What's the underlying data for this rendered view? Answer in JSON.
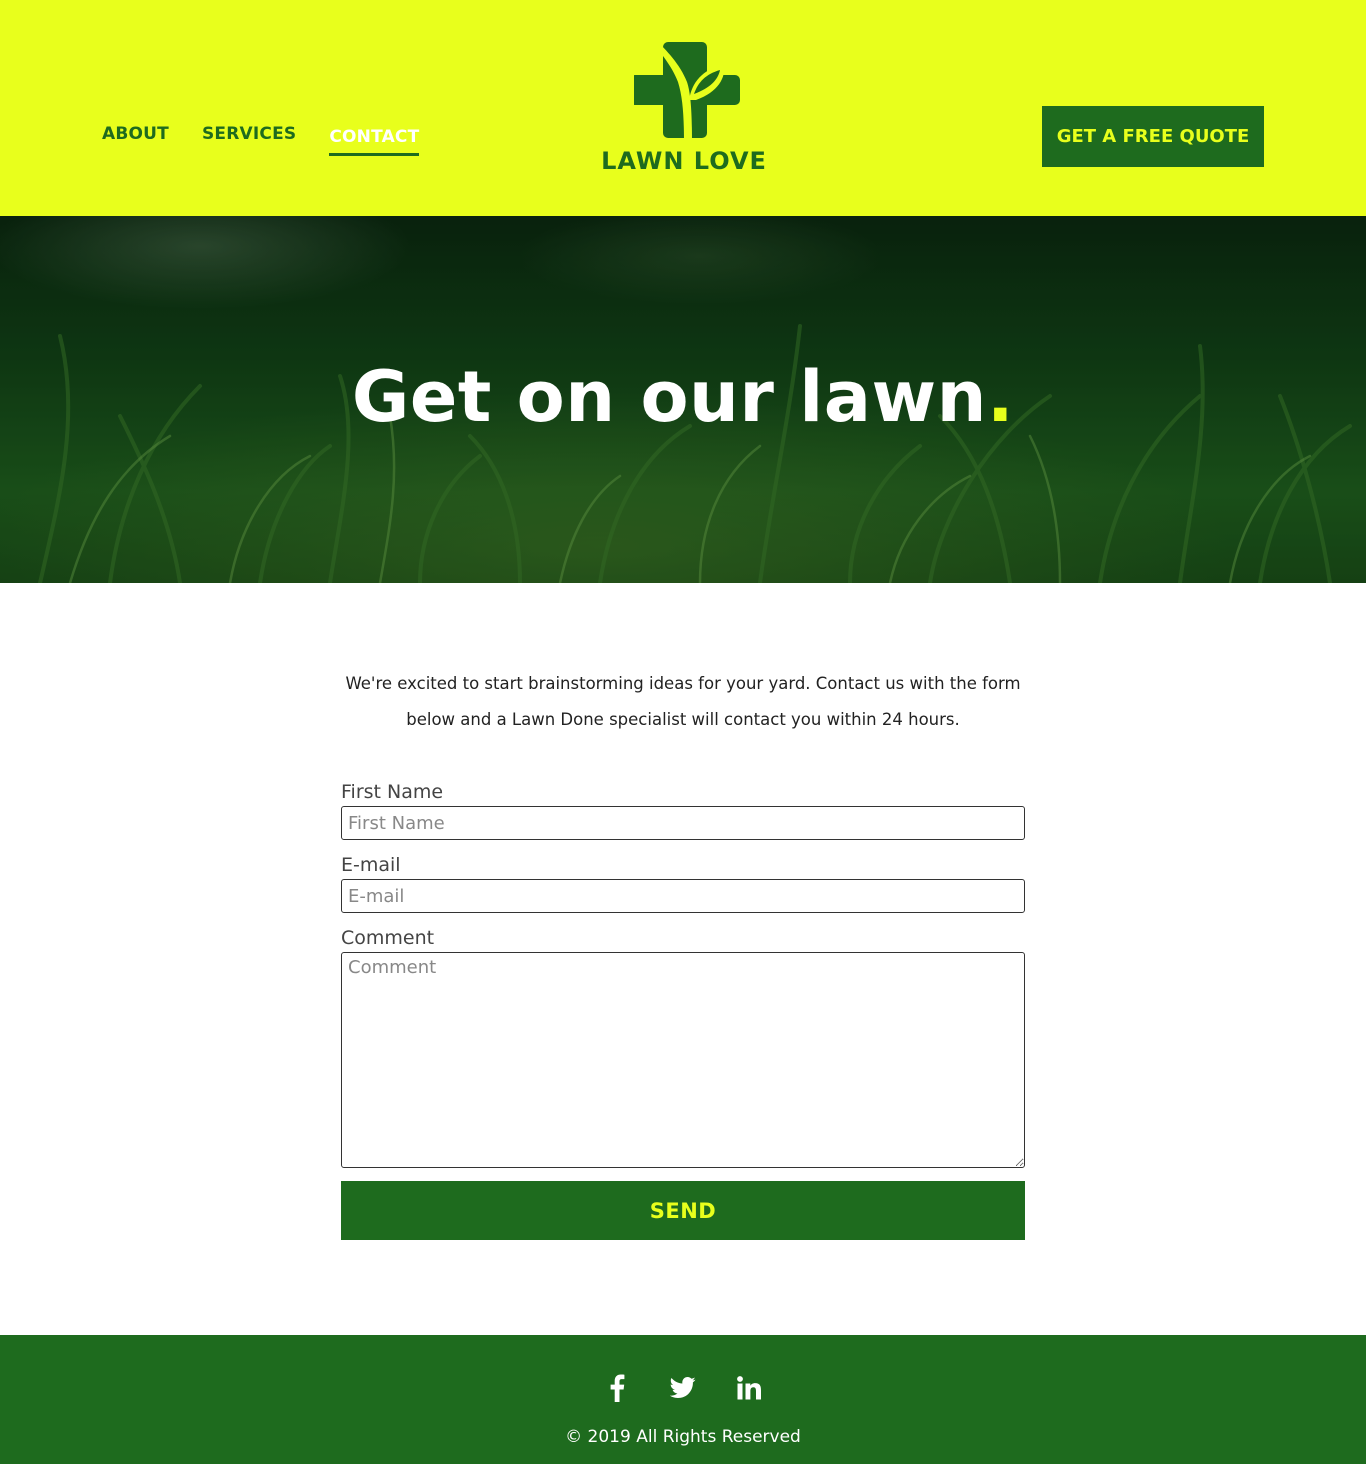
{
  "nav": {
    "items": [
      {
        "label": "ABOUT",
        "active": false
      },
      {
        "label": "SERVICES",
        "active": false
      },
      {
        "label": "CONTACT",
        "active": true
      }
    ]
  },
  "logo": {
    "text": "LAWN LOVE",
    "icon": "cross-leaf-icon"
  },
  "header": {
    "cta_label": "GET A FREE QUOTE"
  },
  "hero": {
    "title": "Get on our lawn",
    "title_accent": "."
  },
  "intro": {
    "text": "We're excited to start brainstorming ideas for your yard. Contact us with the form below and a Lawn Done specialist will contact you within 24 hours."
  },
  "form": {
    "first_name": {
      "label": "First Name",
      "placeholder": "First Name",
      "value": ""
    },
    "email": {
      "label": "E-mail",
      "placeholder": "E-mail",
      "value": ""
    },
    "comment": {
      "label": "Comment",
      "placeholder": "Comment",
      "value": ""
    },
    "submit_label": "SEND"
  },
  "footer": {
    "socials": [
      "facebook-icon",
      "twitter-icon",
      "linkedin-icon"
    ],
    "copyright": "© 2019 All Rights Reserved"
  },
  "colors": {
    "brand_yellow": "#e8ff1c",
    "brand_green": "#1e6b1e",
    "white": "#ffffff"
  }
}
